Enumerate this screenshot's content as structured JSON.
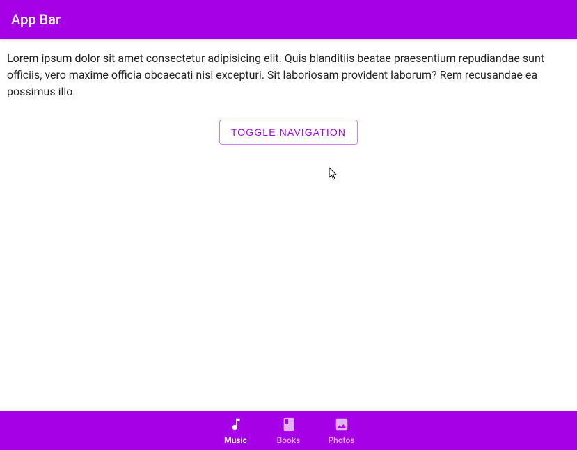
{
  "header": {
    "title": "App Bar"
  },
  "main": {
    "body_text": "Lorem ipsum dolor sit amet consectetur adipisicing elit. Quis blanditiis beatae praesentium repudiandae sunt officiis, vero maxime officia obcaecati nisi excepturi. Sit laboriosam provident laborum? Rem recusandae ea possimus illo.",
    "toggle_button_label": "Toggle Navigation"
  },
  "bottom_nav": {
    "items": [
      {
        "label": "Music",
        "icon": "music-note-icon",
        "active": true
      },
      {
        "label": "Books",
        "icon": "book-icon",
        "active": false
      },
      {
        "label": "Photos",
        "icon": "image-icon",
        "active": false
      }
    ]
  },
  "colors": {
    "primary": "#a600e6"
  }
}
